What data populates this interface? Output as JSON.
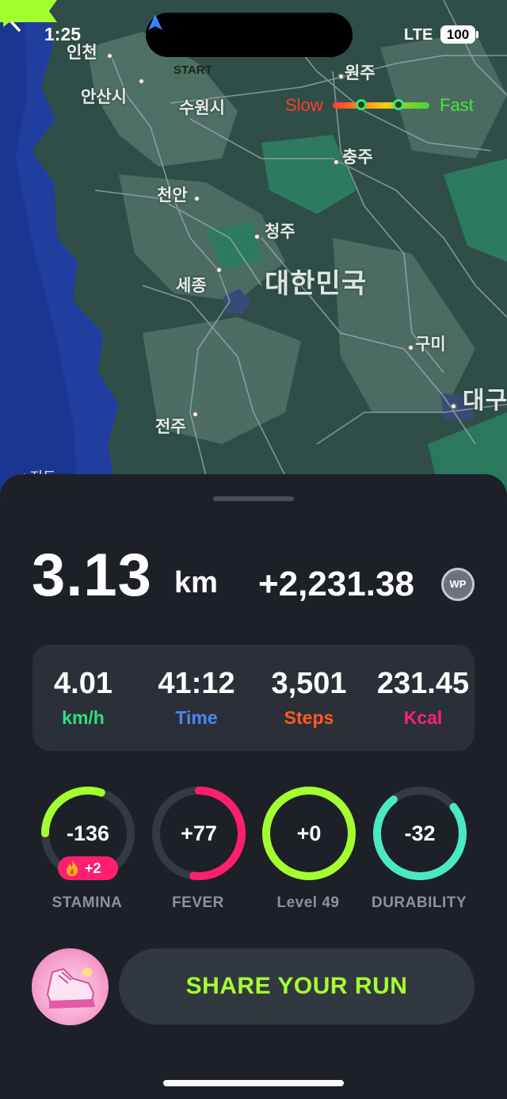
{
  "status_bar": {
    "time": "1:25",
    "network": "LTE",
    "battery": "100"
  },
  "map": {
    "start_label": "START",
    "legend": {
      "slow": "Slow",
      "fast": "Fast"
    },
    "attribution": "< 지도",
    "cities": {
      "incheon": "인천",
      "ansan": "안산시",
      "suwon": "수원시",
      "wonju": "원주",
      "chungju": "충주",
      "cheonan": "천안",
      "cheongju": "청주",
      "sejong": "세종",
      "korea": "대한민국",
      "gumi": "구미",
      "jeonju": "전주",
      "daegu": "대구"
    }
  },
  "summary": {
    "distance_value": "3.13",
    "distance_unit": "km",
    "wp_earned": "+2,231.38",
    "wp_badge": "WP"
  },
  "stats": [
    {
      "value": "4.01",
      "label": "km/h",
      "color": "#2fe07a"
    },
    {
      "value": "41:12",
      "label": "Time",
      "color": "#4a86ff"
    },
    {
      "value": "3,501",
      "label": "Steps",
      "color": "#ff5a1f"
    },
    {
      "value": "231.45",
      "label": "Kcal",
      "color": "#ff1f78"
    }
  ],
  "gauges": [
    {
      "value": "-136",
      "label": "STAMINA",
      "color": "#a4ff2f",
      "fill": 0.3
    },
    {
      "value": "+77",
      "label": "FEVER",
      "color": "#ff1f6e",
      "fill": 0.52
    },
    {
      "value": "+0",
      "label": "Level 49",
      "color": "#a4ff2f",
      "fill": 1.0
    },
    {
      "value": "-32",
      "label": "DURABILITY",
      "color": "#4be9c3",
      "fill": 0.75
    }
  ],
  "stamina_bonus": "+2",
  "share_button": "SHARE YOUR RUN"
}
